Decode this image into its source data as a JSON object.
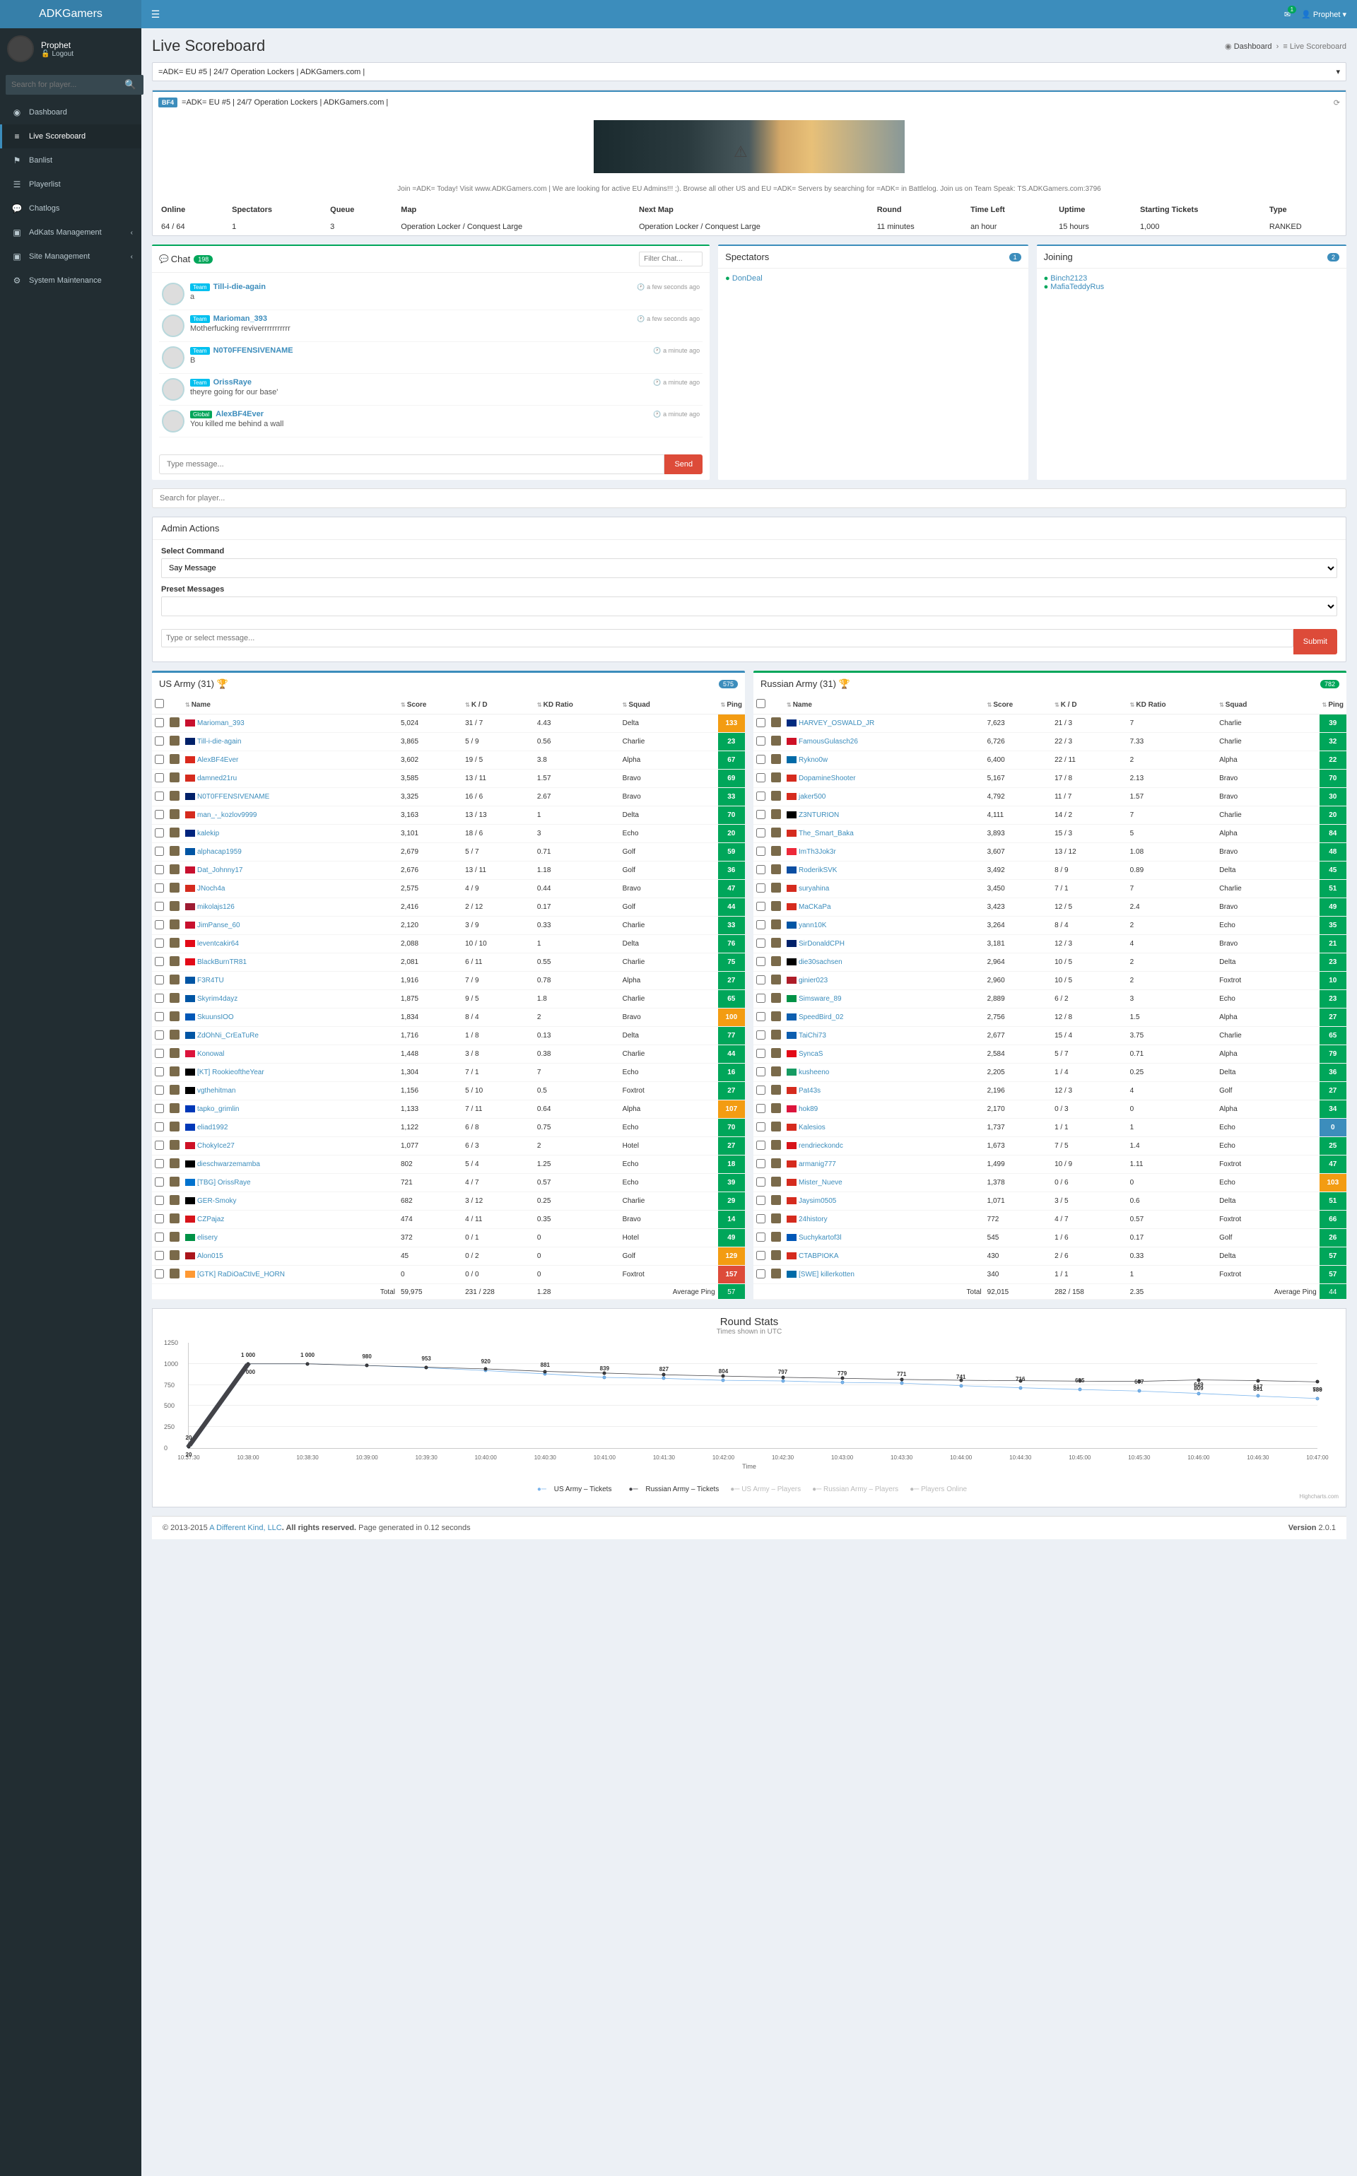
{
  "brand": "ADKGamers",
  "user": {
    "name": "Prophet",
    "logout": "Logout",
    "top_label": "Prophet"
  },
  "top_msg_badge": "1",
  "sidebar": {
    "search_placeholder": "Search for player...",
    "items": [
      {
        "icon": "◉",
        "label": "Dashboard"
      },
      {
        "icon": "≡",
        "label": "Live Scoreboard",
        "active": true
      },
      {
        "icon": "⚑",
        "label": "Banlist"
      },
      {
        "icon": "☰",
        "label": "Playerlist"
      },
      {
        "icon": "💬",
        "label": "Chatlogs"
      },
      {
        "icon": "▣",
        "label": "AdKats Management",
        "sub": true
      },
      {
        "icon": "▣",
        "label": "Site Management",
        "sub": true
      },
      {
        "icon": "⚙",
        "label": "System Maintenance"
      }
    ]
  },
  "page_title": "Live Scoreboard",
  "breadcrumb": {
    "home": "Dashboard",
    "current": "Live Scoreboard"
  },
  "server_select": "=ADK= EU #5 | 24/7 Operation Lockers | ADKGamers.com |",
  "server": {
    "tag": "BF4",
    "name": "=ADK= EU #5 | 24/7 Operation Lockers | ADKGamers.com |"
  },
  "join_text": "Join =ADK= Today! Visit www.ADKGamers.com | We are looking for active EU Admins!!! ;). Browse all other US and EU =ADK= Servers by searching for =ADK= in Battlelog. Join us on Team Speak: TS.ADKGamers.com:3796",
  "info": {
    "headers": [
      "Online",
      "Spectators",
      "Queue",
      "Map",
      "Next Map",
      "Round",
      "Time Left",
      "Uptime",
      "Starting Tickets",
      "Type"
    ],
    "values": [
      "64 / 64",
      "1",
      "3",
      "Operation Locker / Conquest Large",
      "Operation Locker / Conquest Large",
      "11 minutes",
      "an hour",
      "15 hours",
      "1,000",
      "RANKED"
    ]
  },
  "chat": {
    "title": "Chat",
    "count": "198",
    "filter_placeholder": "Filter Chat...",
    "input_placeholder": "Type message...",
    "send": "Send",
    "messages": [
      {
        "tag": "Team",
        "name": "Till-i-die-again",
        "time": "a few seconds ago",
        "text": "a"
      },
      {
        "tag": "Team",
        "name": "Marioman_393",
        "time": "a few seconds ago",
        "text": "Motherfucking reviverrrrrrrrrrr"
      },
      {
        "tag": "Team",
        "name": "N0T0FFENSIVENAME",
        "time": "a minute ago",
        "text": "B"
      },
      {
        "tag": "Team",
        "name": "OrissRaye",
        "time": "a minute ago",
        "text": "theyre going for our base'"
      },
      {
        "tag": "Global",
        "name": "AlexBF4Ever",
        "time": "a minute ago",
        "text": "You killed me behind a wall"
      }
    ]
  },
  "spectators": {
    "title": "Spectators",
    "count": "1",
    "items": [
      "DonDeal"
    ]
  },
  "joining": {
    "title": "Joining",
    "count": "2",
    "items": [
      "Binch2123",
      "MafiaTeddyRus"
    ]
  },
  "player_search_placeholder": "Search for player...",
  "admin": {
    "title": "Admin Actions",
    "select_cmd_label": "Select Command",
    "select_cmd_value": "Say Message",
    "preset_label": "Preset Messages",
    "preset_value": "",
    "msg_placeholder": "Type or select message...",
    "submit": "Submit"
  },
  "columns": [
    "",
    "",
    "Name",
    "Score",
    "K / D",
    "KD Ratio",
    "Squad",
    "Ping"
  ],
  "team_us": {
    "name": "US Army (31)",
    "total_badge": "575",
    "players": [
      {
        "flag": "#c8102e",
        "name": "Marioman_393",
        "score": "5,024",
        "kd": "31 / 7",
        "kdr": "4.43",
        "squad": "Delta",
        "ping": "133",
        "pc": "ping-yellow"
      },
      {
        "flag": "#012169",
        "name": "Till-i-die-again",
        "score": "3,865",
        "kd": "5 / 9",
        "kdr": "0.56",
        "squad": "Charlie",
        "ping": "23",
        "pc": "ping-green"
      },
      {
        "flag": "#DA291C",
        "name": "AlexBF4Ever",
        "score": "3,602",
        "kd": "19 / 5",
        "kdr": "3.8",
        "squad": "Alpha",
        "ping": "67",
        "pc": "ping-green"
      },
      {
        "flag": "#d52b1e",
        "name": "damned21ru",
        "score": "3,585",
        "kd": "13 / 11",
        "kdr": "1.57",
        "squad": "Bravo",
        "ping": "69",
        "pc": "ping-green"
      },
      {
        "flag": "#012169",
        "name": "N0T0FFENSIVENAME",
        "score": "3,325",
        "kd": "16 / 6",
        "kdr": "2.67",
        "squad": "Bravo",
        "ping": "33",
        "pc": "ping-green"
      },
      {
        "flag": "#d52b1e",
        "name": "man_-_kozlov9999",
        "score": "3,163",
        "kd": "13 / 13",
        "kdr": "1",
        "squad": "Delta",
        "ping": "70",
        "pc": "ping-green"
      },
      {
        "flag": "#00247d",
        "name": "kalekip",
        "score": "3,101",
        "kd": "18 / 6",
        "kdr": "3",
        "squad": "Echo",
        "ping": "20",
        "pc": "ping-green"
      },
      {
        "flag": "#0055a4",
        "name": "alphacap1959",
        "score": "2,679",
        "kd": "5 / 7",
        "kdr": "0.71",
        "squad": "Golf",
        "ping": "59",
        "pc": "ping-green"
      },
      {
        "flag": "#c8102e",
        "name": "Dat_Johnny17",
        "score": "2,676",
        "kd": "13 / 11",
        "kdr": "1.18",
        "squad": "Golf",
        "ping": "36",
        "pc": "ping-green"
      },
      {
        "flag": "#d52b1e",
        "name": "JNoch4a",
        "score": "2,575",
        "kd": "4 / 9",
        "kdr": "0.44",
        "squad": "Bravo",
        "ping": "47",
        "pc": "ping-green"
      },
      {
        "flag": "#9e1b32",
        "name": "mikolajs126",
        "score": "2,416",
        "kd": "2 / 12",
        "kdr": "0.17",
        "squad": "Golf",
        "ping": "44",
        "pc": "ping-green"
      },
      {
        "flag": "#c8102e",
        "name": "JimPanse_60",
        "score": "2,120",
        "kd": "3 / 9",
        "kdr": "0.33",
        "squad": "Charlie",
        "ping": "33",
        "pc": "ping-green"
      },
      {
        "flag": "#e30a17",
        "name": "leventcakir64",
        "score": "2,088",
        "kd": "10 / 10",
        "kdr": "1",
        "squad": "Delta",
        "ping": "76",
        "pc": "ping-green"
      },
      {
        "flag": "#e30a17",
        "name": "BlackBurnTR81",
        "score": "2,081",
        "kd": "6 / 11",
        "kdr": "0.55",
        "squad": "Charlie",
        "ping": "75",
        "pc": "ping-green"
      },
      {
        "flag": "#0055a4",
        "name": "F3R4TU",
        "score": "1,916",
        "kd": "7 / 9",
        "kdr": "0.78",
        "squad": "Alpha",
        "ping": "27",
        "pc": "ping-green"
      },
      {
        "flag": "#0055a4",
        "name": "Skyrim4dayz",
        "score": "1,875",
        "kd": "9 / 5",
        "kdr": "1.8",
        "squad": "Charlie",
        "ping": "65",
        "pc": "ping-green"
      },
      {
        "flag": "#0057b7",
        "name": "SkuunsIOO",
        "score": "1,834",
        "kd": "8 / 4",
        "kdr": "2",
        "squad": "Bravo",
        "ping": "100",
        "pc": "ping-yellow"
      },
      {
        "flag": "#0055a4",
        "name": "ZdOhNi_CrEaTuRe",
        "score": "1,716",
        "kd": "1 / 8",
        "kdr": "0.13",
        "squad": "Delta",
        "ping": "77",
        "pc": "ping-green"
      },
      {
        "flag": "#dc143c",
        "name": "Konowal",
        "score": "1,448",
        "kd": "3 / 8",
        "kdr": "0.38",
        "squad": "Charlie",
        "ping": "44",
        "pc": "ping-green"
      },
      {
        "flag": "#000",
        "name": "[KT] RookieoftheYear",
        "score": "1,304",
        "kd": "7 / 1",
        "kdr": "7",
        "squad": "Echo",
        "ping": "16",
        "pc": "ping-green"
      },
      {
        "flag": "#000",
        "name": "vgthehitman",
        "score": "1,156",
        "kd": "5 / 10",
        "kdr": "0.5",
        "squad": "Foxtrot",
        "ping": "27",
        "pc": "ping-green"
      },
      {
        "flag": "#0038b8",
        "name": "tapko_grimlin",
        "score": "1,133",
        "kd": "7 / 11",
        "kdr": "0.64",
        "squad": "Alpha",
        "ping": "107",
        "pc": "ping-yellow"
      },
      {
        "flag": "#0038b8",
        "name": "eliad1992",
        "score": "1,122",
        "kd": "6 / 8",
        "kdr": "0.75",
        "squad": "Echo",
        "ping": "70",
        "pc": "ping-green"
      },
      {
        "flag": "#ce1126",
        "name": "ChokyIce27",
        "score": "1,077",
        "kd": "6 / 3",
        "kdr": "2",
        "squad": "Hotel",
        "ping": "27",
        "pc": "ping-green"
      },
      {
        "flag": "#000",
        "name": "dieschwarzemamba",
        "score": "802",
        "kd": "5 / 4",
        "kdr": "1.25",
        "squad": "Echo",
        "ping": "18",
        "pc": "ping-green"
      },
      {
        "flag": "#0072ce",
        "name": "[TBG] OrissRaye",
        "score": "721",
        "kd": "4 / 7",
        "kdr": "0.57",
        "squad": "Echo",
        "ping": "39",
        "pc": "ping-green"
      },
      {
        "flag": "#000",
        "name": "GER-Smoky",
        "score": "682",
        "kd": "3 / 12",
        "kdr": "0.25",
        "squad": "Charlie",
        "ping": "29",
        "pc": "ping-green"
      },
      {
        "flag": "#d7141a",
        "name": "CZPajaz",
        "score": "474",
        "kd": "4 / 11",
        "kdr": "0.35",
        "squad": "Bravo",
        "ping": "14",
        "pc": "ping-green"
      },
      {
        "flag": "#009246",
        "name": "elisery",
        "score": "372",
        "kd": "0 / 1",
        "kdr": "0",
        "squad": "Hotel",
        "ping": "49",
        "pc": "ping-green"
      },
      {
        "flag": "#aa151b",
        "name": "Alon015",
        "score": "45",
        "kd": "0 / 2",
        "kdr": "0",
        "squad": "Golf",
        "ping": "129",
        "pc": "ping-yellow"
      },
      {
        "flag": "#ff9933",
        "name": "[GTK] RaDiOaCtIvE_HORN",
        "score": "0",
        "kd": "0 / 0",
        "kdr": "0",
        "squad": "Foxtrot",
        "ping": "157",
        "pc": "ping-red"
      }
    ],
    "totals": {
      "label": "Total",
      "score": "59,975",
      "kd": "231 / 228",
      "kdr": "1.28",
      "avg_label": "Average Ping",
      "avg": "57"
    }
  },
  "team_ru": {
    "name": "Russian Army (31)",
    "total_badge": "782",
    "players": [
      {
        "flag": "#002b7f",
        "name": "HARVEY_OSWALD_JR",
        "score": "7,623",
        "kd": "21 / 3",
        "kdr": "7",
        "squad": "Charlie",
        "ping": "39",
        "pc": "ping-green"
      },
      {
        "flag": "#ce1126",
        "name": "FamousGulasch26",
        "score": "6,726",
        "kd": "22 / 3",
        "kdr": "7.33",
        "squad": "Charlie",
        "ping": "32",
        "pc": "ping-green"
      },
      {
        "flag": "#006aa7",
        "name": "Rykno0w",
        "score": "6,400",
        "kd": "22 / 11",
        "kdr": "2",
        "squad": "Alpha",
        "ping": "22",
        "pc": "ping-green"
      },
      {
        "flag": "#d52b1e",
        "name": "DopamineShooter",
        "score": "5,167",
        "kd": "17 / 8",
        "kdr": "2.13",
        "squad": "Bravo",
        "ping": "70",
        "pc": "ping-green"
      },
      {
        "flag": "#d52b1e",
        "name": "jaker500",
        "score": "4,792",
        "kd": "11 / 7",
        "kdr": "1.57",
        "squad": "Bravo",
        "ping": "30",
        "pc": "ping-green"
      },
      {
        "flag": "#000",
        "name": "Z3NTURION",
        "score": "4,111",
        "kd": "14 / 2",
        "kdr": "7",
        "squad": "Charlie",
        "ping": "20",
        "pc": "ping-green"
      },
      {
        "flag": "#d52b1e",
        "name": "The_Smart_Baka",
        "score": "3,893",
        "kd": "15 / 3",
        "kdr": "5",
        "squad": "Alpha",
        "ping": "84",
        "pc": "ping-green"
      },
      {
        "flag": "#ed2939",
        "name": "ImTh3Jok3r",
        "score": "3,607",
        "kd": "13 / 12",
        "kdr": "1.08",
        "squad": "Bravo",
        "ping": "48",
        "pc": "ping-green"
      },
      {
        "flag": "#0b4ea2",
        "name": "RoderikSVK",
        "score": "3,492",
        "kd": "8 / 9",
        "kdr": "0.89",
        "squad": "Delta",
        "ping": "45",
        "pc": "ping-green"
      },
      {
        "flag": "#d52b1e",
        "name": "suryahina",
        "score": "3,450",
        "kd": "7 / 1",
        "kdr": "7",
        "squad": "Charlie",
        "ping": "51",
        "pc": "ping-green"
      },
      {
        "flag": "#d52b1e",
        "name": "MaCKaPa",
        "score": "3,423",
        "kd": "12 / 5",
        "kdr": "2.4",
        "squad": "Bravo",
        "ping": "49",
        "pc": "ping-green"
      },
      {
        "flag": "#0055a4",
        "name": "yann10K",
        "score": "3,264",
        "kd": "8 / 4",
        "kdr": "2",
        "squad": "Echo",
        "ping": "35",
        "pc": "ping-green"
      },
      {
        "flag": "#012169",
        "name": "SirDonaldCPH",
        "score": "3,181",
        "kd": "12 / 3",
        "kdr": "4",
        "squad": "Bravo",
        "ping": "21",
        "pc": "ping-green"
      },
      {
        "flag": "#000",
        "name": "die30sachsen",
        "score": "2,964",
        "kd": "10 / 5",
        "kdr": "2",
        "squad": "Delta",
        "ping": "23",
        "pc": "ping-green"
      },
      {
        "flag": "#ae1c28",
        "name": "ginier023",
        "score": "2,960",
        "kd": "10 / 5",
        "kdr": "2",
        "squad": "Foxtrot",
        "ping": "10",
        "pc": "ping-green"
      },
      {
        "flag": "#009246",
        "name": "Simsware_89",
        "score": "2,889",
        "kd": "6 / 2",
        "kdr": "3",
        "squad": "Echo",
        "ping": "23",
        "pc": "ping-green"
      },
      {
        "flag": "#0d5eaf",
        "name": "SpeedBird_02",
        "score": "2,756",
        "kd": "12 / 8",
        "kdr": "1.5",
        "squad": "Alpha",
        "ping": "27",
        "pc": "ping-green"
      },
      {
        "flag": "#0d5eaf",
        "name": "TaiChi73",
        "score": "2,677",
        "kd": "15 / 4",
        "kdr": "3.75",
        "squad": "Charlie",
        "ping": "65",
        "pc": "ping-green"
      },
      {
        "flag": "#e30a17",
        "name": "SyncaS",
        "score": "2,584",
        "kd": "5 / 7",
        "kdr": "0.71",
        "squad": "Alpha",
        "ping": "79",
        "pc": "ping-green"
      },
      {
        "flag": "#169b62",
        "name": "kusheeno",
        "score": "2,205",
        "kd": "1 / 4",
        "kdr": "0.25",
        "squad": "Delta",
        "ping": "36",
        "pc": "ping-green"
      },
      {
        "flag": "#d52b1e",
        "name": "Pat43s",
        "score": "2,196",
        "kd": "12 / 3",
        "kdr": "4",
        "squad": "Golf",
        "ping": "27",
        "pc": "ping-green"
      },
      {
        "flag": "#dc143c",
        "name": "hok89",
        "score": "2,170",
        "kd": "0 / 3",
        "kdr": "0",
        "squad": "Alpha",
        "ping": "34",
        "pc": "ping-green"
      },
      {
        "flag": "#d52b1e",
        "name": "Kalesios",
        "score": "1,737",
        "kd": "1 / 1",
        "kdr": "1",
        "squad": "Echo",
        "ping": "0",
        "pc": "ping-blue"
      },
      {
        "flag": "#d7141a",
        "name": "rendrieckondc",
        "score": "1,673",
        "kd": "7 / 5",
        "kdr": "1.4",
        "squad": "Echo",
        "ping": "25",
        "pc": "ping-green"
      },
      {
        "flag": "#d52b1e",
        "name": "armanig777",
        "score": "1,499",
        "kd": "10 / 9",
        "kdr": "1.11",
        "squad": "Foxtrot",
        "ping": "47",
        "pc": "ping-green"
      },
      {
        "flag": "#d52b1e",
        "name": "Mister_Nueve",
        "score": "1,378",
        "kd": "0 / 6",
        "kdr": "0",
        "squad": "Echo",
        "ping": "103",
        "pc": "ping-yellow"
      },
      {
        "flag": "#d52b1e",
        "name": "Jaysim0505",
        "score": "1,071",
        "kd": "3 / 5",
        "kdr": "0.6",
        "squad": "Delta",
        "ping": "51",
        "pc": "ping-green"
      },
      {
        "flag": "#d52b1e",
        "name": "24history",
        "score": "772",
        "kd": "4 / 7",
        "kdr": "0.57",
        "squad": "Foxtrot",
        "ping": "66",
        "pc": "ping-green"
      },
      {
        "flag": "#0057b7",
        "name": "Suchykartof3l",
        "score": "545",
        "kd": "1 / 6",
        "kdr": "0.17",
        "squad": "Golf",
        "ping": "26",
        "pc": "ping-green"
      },
      {
        "flag": "#d52b1e",
        "name": "CTABPIOKA",
        "score": "430",
        "kd": "2 / 6",
        "kdr": "0.33",
        "squad": "Delta",
        "ping": "57",
        "pc": "ping-green"
      },
      {
        "flag": "#006aa7",
        "name": "[SWE] killerkotten",
        "score": "340",
        "kd": "1 / 1",
        "kdr": "1",
        "squad": "Foxtrot",
        "ping": "57",
        "pc": "ping-green"
      }
    ],
    "totals": {
      "label": "Total",
      "score": "92,015",
      "kd": "282 / 158",
      "kdr": "2.35",
      "avg_label": "Average Ping",
      "avg": "44"
    }
  },
  "chart_data": {
    "type": "line",
    "title": "Round Stats",
    "subtitle": "Times shown in UTC",
    "xlabel": "Time",
    "ylabel": "",
    "ylim": [
      0,
      1250
    ],
    "x": [
      "10:37:30",
      "10:38:00",
      "10:38:30",
      "10:39:00",
      "10:39:30",
      "10:40:00",
      "10:40:30",
      "10:41:00",
      "10:41:30",
      "10:42:00",
      "10:42:30",
      "10:43:00",
      "10:43:30",
      "10:44:00",
      "10:44:30",
      "10:45:00",
      "10:45:30",
      "10:46:00",
      "10:46:30",
      "10:47:00"
    ],
    "series": [
      {
        "name": "US Army – Tickets",
        "color": "#7cb5ec",
        "values": [
          20,
          1000,
          1000,
          980,
          953,
          920,
          881,
          839,
          827,
          804,
          797,
          779,
          771,
          741,
          716,
          695,
          677,
          649,
          617,
          589
        ]
      },
      {
        "name": "Russian Army – Tickets",
        "color": "#434348",
        "values": [
          20,
          1000,
          1000,
          980,
          960,
          940,
          910,
          890,
          870,
          855,
          840,
          828,
          815,
          805,
          800,
          795,
          792,
          809,
          801,
          786
        ]
      }
    ],
    "legend_disabled": [
      "US Army – Players",
      "Russian Army – Players",
      "Players Online"
    ]
  },
  "highcharts_credit": "Highcharts.com",
  "footer": {
    "copy": "© 2013-2015 ",
    "brand": "A Different Kind, LLC",
    "rights": ". All rights reserved.",
    "gen": " Page generated in 0.12 seconds",
    "ver_label": "Version ",
    "ver": "2.0.1"
  }
}
